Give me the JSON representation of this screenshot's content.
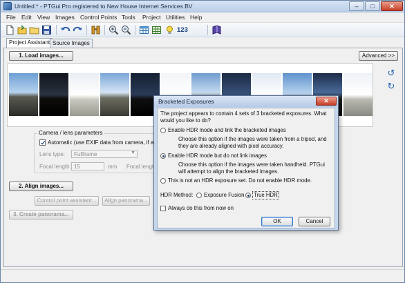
{
  "window": {
    "title": "Untitled * - PTGui Pro registered to New House Internet Services BV",
    "min_label": "–",
    "max_label": "□",
    "close_label": "✕"
  },
  "menu": [
    "File",
    "Edit",
    "View",
    "Images",
    "Control Points",
    "Tools",
    "Project",
    "Utilities",
    "Help"
  ],
  "toolbar": {
    "icons": [
      "new-icon",
      "open-icon",
      "open-folder-icon",
      "save-icon",
      "undo-icon",
      "redo-icon",
      "panorama-editor-icon",
      "zoom-in-icon",
      "zoom-out-icon",
      "table-icon",
      "grid-icon",
      "bulb-icon",
      "numbers-icon",
      "book-icon"
    ],
    "numbers_label": "123"
  },
  "tabs": [
    "Project Assistant",
    "Source Images"
  ],
  "main": {
    "load_images": "1. Load images...",
    "advanced": "Advanced >>",
    "rotate_left_icon": "↺",
    "rotate_right_icon": "↻",
    "camera_group_title": "Camera / lens parameters",
    "automatic_label": "Automatic (use EXIF data from camera, if availa",
    "lens_type_label": "Lens type:",
    "lens_type_value": "Fullframe",
    "focal_length_label": "Focal length:",
    "focal_length_value": "15",
    "focal_unit": "mm",
    "focal_length_label2": "Focal length:",
    "align_images": "2. Align images...",
    "cp_assistant": "Control point assistant...",
    "align_panorama": "Align panorama...",
    "create_panorama": "3. Create panorama..."
  },
  "dialog": {
    "title": "Bracketed Exposures",
    "close_label": "✕",
    "intro": "The project appears to contain 4 sets of 3 bracketed exposures. What would you like to do?",
    "option1": "Enable HDR mode and link the bracketed images",
    "option1_desc": "Choose this option if the images were taken from a tripod, and they are already aligned with pixel accuracy.",
    "option2": "Enable HDR mode but do not link images",
    "option2_desc": "Choose this option if the images were taken handheld. PTGui will attempt to align the bracketed images.",
    "option3": "This is not an HDR exposure set. Do not enable HDR mode.",
    "selected_option": 2,
    "hdr_method_label": "HDR Method:",
    "exposure_fusion": "Exposure Fusion",
    "true_hdr": "True HDR",
    "hdr_method_selected": "True HDR",
    "always_do": "Always do this from now on",
    "ok": "OK",
    "cancel": "Cancel"
  },
  "colors": {
    "title_gradient_top": "#d6e3f3",
    "close_red": "#c8402a",
    "sky_blue": "#6f9ccf"
  }
}
